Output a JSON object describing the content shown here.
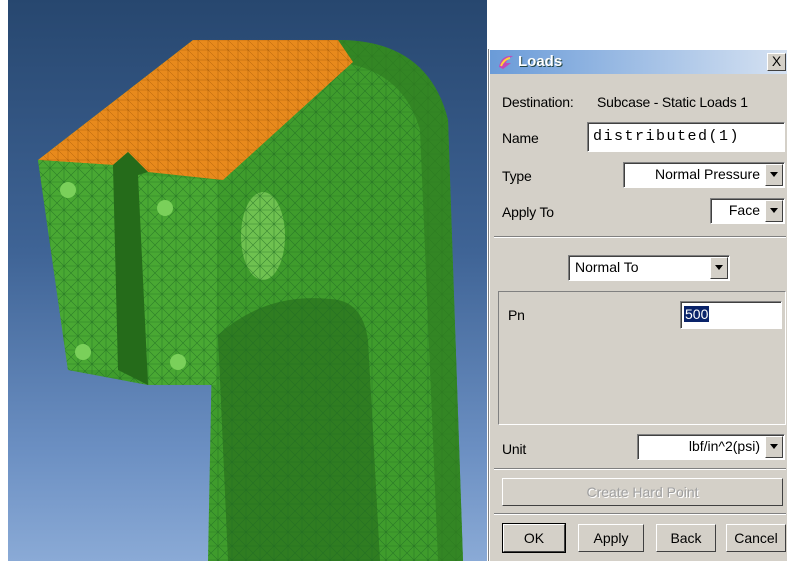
{
  "dialog": {
    "title": "Loads",
    "close_label": "X",
    "destination_label": "Destination:",
    "destination_value": "Subcase - Static Loads 1",
    "name_label": "Name",
    "name_value": "distributed(1)",
    "type_label": "Type",
    "type_value": "Normal Pressure",
    "apply_to_label": "Apply To",
    "apply_to_value": "Face",
    "direction_value": "Normal To",
    "pn_label": "Pn",
    "pn_value": "500",
    "unit_label": "Unit",
    "unit_value": "lbf/in^2(psi)",
    "create_hard_point_label": "Create Hard Point",
    "ok_label": "OK",
    "apply_label": "Apply",
    "back_label": "Back",
    "cancel_label": "Cancel"
  },
  "colors": {
    "mesh_green": "#3f9c2c",
    "selected_face_orange": "#e88a1c",
    "background_blue": "#3f6496",
    "title_gradient": "#6a9bd8"
  }
}
